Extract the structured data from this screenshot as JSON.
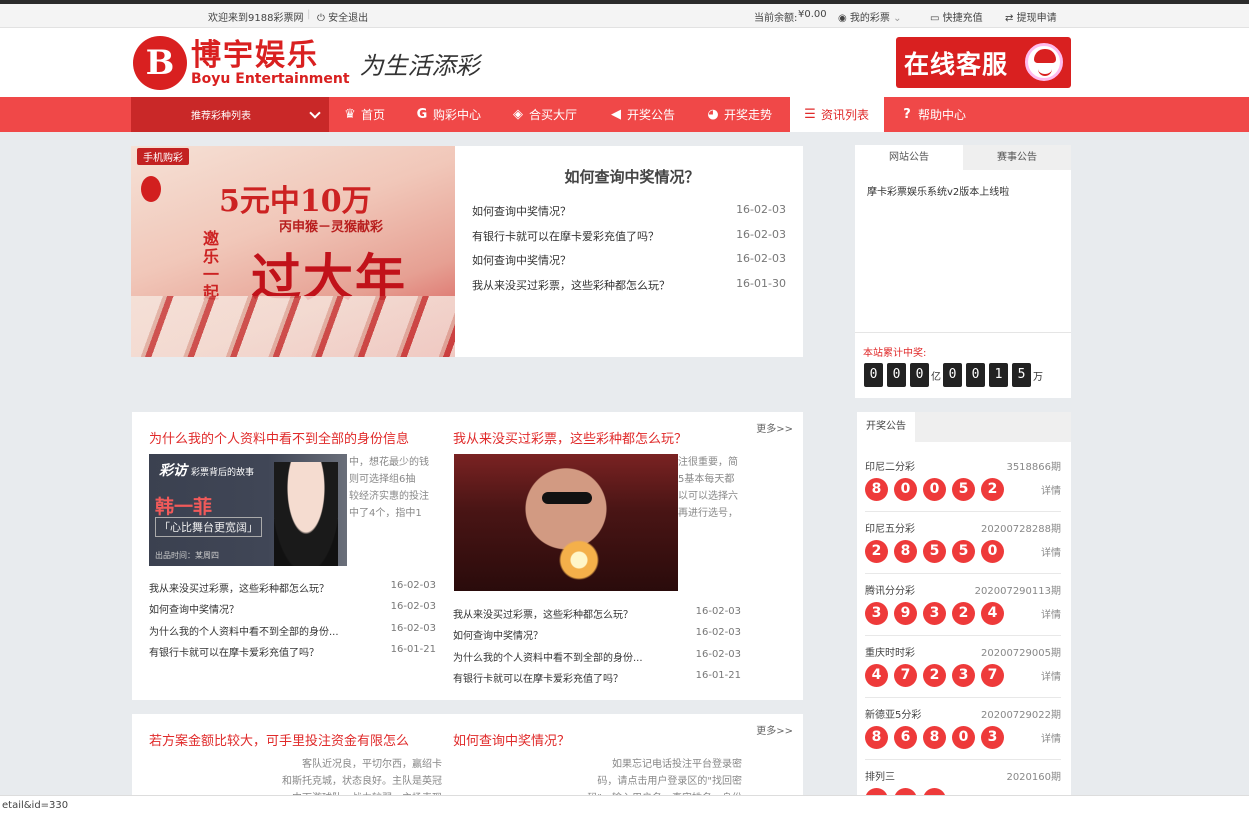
{
  "topbar": {
    "welcome": "欢迎来到9188彩票网",
    "logout": "安全退出",
    "balance_label": "当前余额:",
    "balance_value": "¥0.00",
    "my_lottery": "我的彩票",
    "recharge": "快捷充值",
    "withdraw": "提现申请"
  },
  "header": {
    "logo_char": "B",
    "logo_cn": "博宇娱乐",
    "logo_en": "Boyu Entertainment",
    "slogan": "为生活添彩",
    "service": "在线客服"
  },
  "nav": {
    "dropdown": "推荐彩种列表",
    "items": [
      {
        "label": "首页",
        "icon": "trophy-icon"
      },
      {
        "label": "购彩中心",
        "icon": "g-icon"
      },
      {
        "label": "合买大厅",
        "icon": "handshake-icon"
      },
      {
        "label": "开奖公告",
        "icon": "megaphone-icon"
      },
      {
        "label": "开奖走势",
        "icon": "piechart-icon"
      },
      {
        "label": "资讯列表",
        "icon": "list-icon"
      },
      {
        "label": "帮助中心",
        "icon": "help-icon"
      }
    ]
  },
  "banner": {
    "tag": "手机购彩",
    "headline": "5元中10万",
    "sub": "丙申猴－灵猴献彩",
    "side": "邀乐一起",
    "big": "过大年",
    "news_title": "如何查询中奖情况？",
    "news": [
      {
        "title": "如何查询中奖情况？",
        "date": "16-02-03"
      },
      {
        "title": "有银行卡就可以在摩卡爱彩充值了吗？",
        "date": "16-02-03"
      },
      {
        "title": "如何查询中奖情况？",
        "date": "16-02-03"
      },
      {
        "title": "我从来没买过彩票，这些彩种都怎么玩？",
        "date": "16-01-30"
      }
    ]
  },
  "notice": {
    "tabs": [
      "网站公告",
      "赛事公告"
    ],
    "text": "摩卡彩票娱乐系统v2版本上线啦",
    "jackpot_label": "本站累计中奖:",
    "digits": [
      "0",
      "0",
      "0",
      "0",
      "0",
      "1",
      "5"
    ],
    "unit_yi": "亿",
    "unit_wan": "万"
  },
  "draws": {
    "tab": "开奖公告",
    "detail_label": "详情",
    "items": [
      {
        "name": "印尼二分彩",
        "issue": "3518866期",
        "balls": [
          "8",
          "0",
          "0",
          "5",
          "2"
        ]
      },
      {
        "name": "印尼五分彩",
        "issue": "20200728288期",
        "balls": [
          "2",
          "8",
          "5",
          "5",
          "0"
        ]
      },
      {
        "name": "腾讯分分彩",
        "issue": "202007290113期",
        "balls": [
          "3",
          "9",
          "3",
          "2",
          "4"
        ]
      },
      {
        "name": "重庆时时彩",
        "issue": "20200729005期",
        "balls": [
          "4",
          "7",
          "2",
          "3",
          "7"
        ]
      },
      {
        "name": "新德亚5分彩",
        "issue": "20200729022期",
        "balls": [
          "8",
          "6",
          "8",
          "0",
          "3"
        ]
      },
      {
        "name": "排列三",
        "issue": "2020160期",
        "balls": []
      }
    ]
  },
  "articles1": {
    "more": "更多>>",
    "left": {
      "title": "为什么我的个人资料中看不到全部的身份信息",
      "thumb_badge": "彩访",
      "thumb_badge_sub": "彩票背后的故事",
      "thumb_name": "韩一菲",
      "thumb_quote": "「心比舞台更宽阔」",
      "thumb_foot": "出品时间：某周四",
      "excerpt": "中，想花最少的钱\n则可选择组6抽\n较经济实惠的投注\n中了4个，指中1",
      "list": [
        {
          "title": "我从来没买过彩票，这些彩种都怎么玩？",
          "date": "16-02-03"
        },
        {
          "title": "如何查询中奖情况？",
          "date": "16-02-03"
        },
        {
          "title": "为什么我的个人资料中看不到全部的身份...",
          "date": "16-02-03"
        },
        {
          "title": "有银行卡就可以在摩卡爱彩充值了吗？",
          "date": "16-01-21"
        }
      ]
    },
    "right": {
      "title": "我从来没买过彩票，这些彩种都怎么玩？",
      "excerpt": "注很重要，简\n5基本每天都\n以可以选择六\n再进行选号，",
      "list": [
        {
          "title": "我从来没买过彩票，这些彩种都怎么玩？",
          "date": "16-02-03"
        },
        {
          "title": "如何查询中奖情况？",
          "date": "16-02-03"
        },
        {
          "title": "为什么我的个人资料中看不到全部的身份...",
          "date": "16-02-03"
        },
        {
          "title": "有银行卡就可以在摩卡爱彩充值了吗？",
          "date": "16-01-21"
        }
      ]
    }
  },
  "articles2": {
    "more": "更多>>",
    "left": {
      "title": "若方案金额比较大，可手里投注资金有限怎么",
      "excerpt": "客队近况良，平切尔西，赢绍卡\n和斯托克城，状态良好。主队是英冠\n中下游球队，战力较弱，主场表现"
    },
    "right": {
      "title": "如何查询中奖情况？",
      "excerpt": "如果忘记电话投注平台登录密\n码，请点击用户登录区的\"找回密\n码\"，输入用户名，真实姓名，身份"
    }
  },
  "status": "etail&id=330"
}
